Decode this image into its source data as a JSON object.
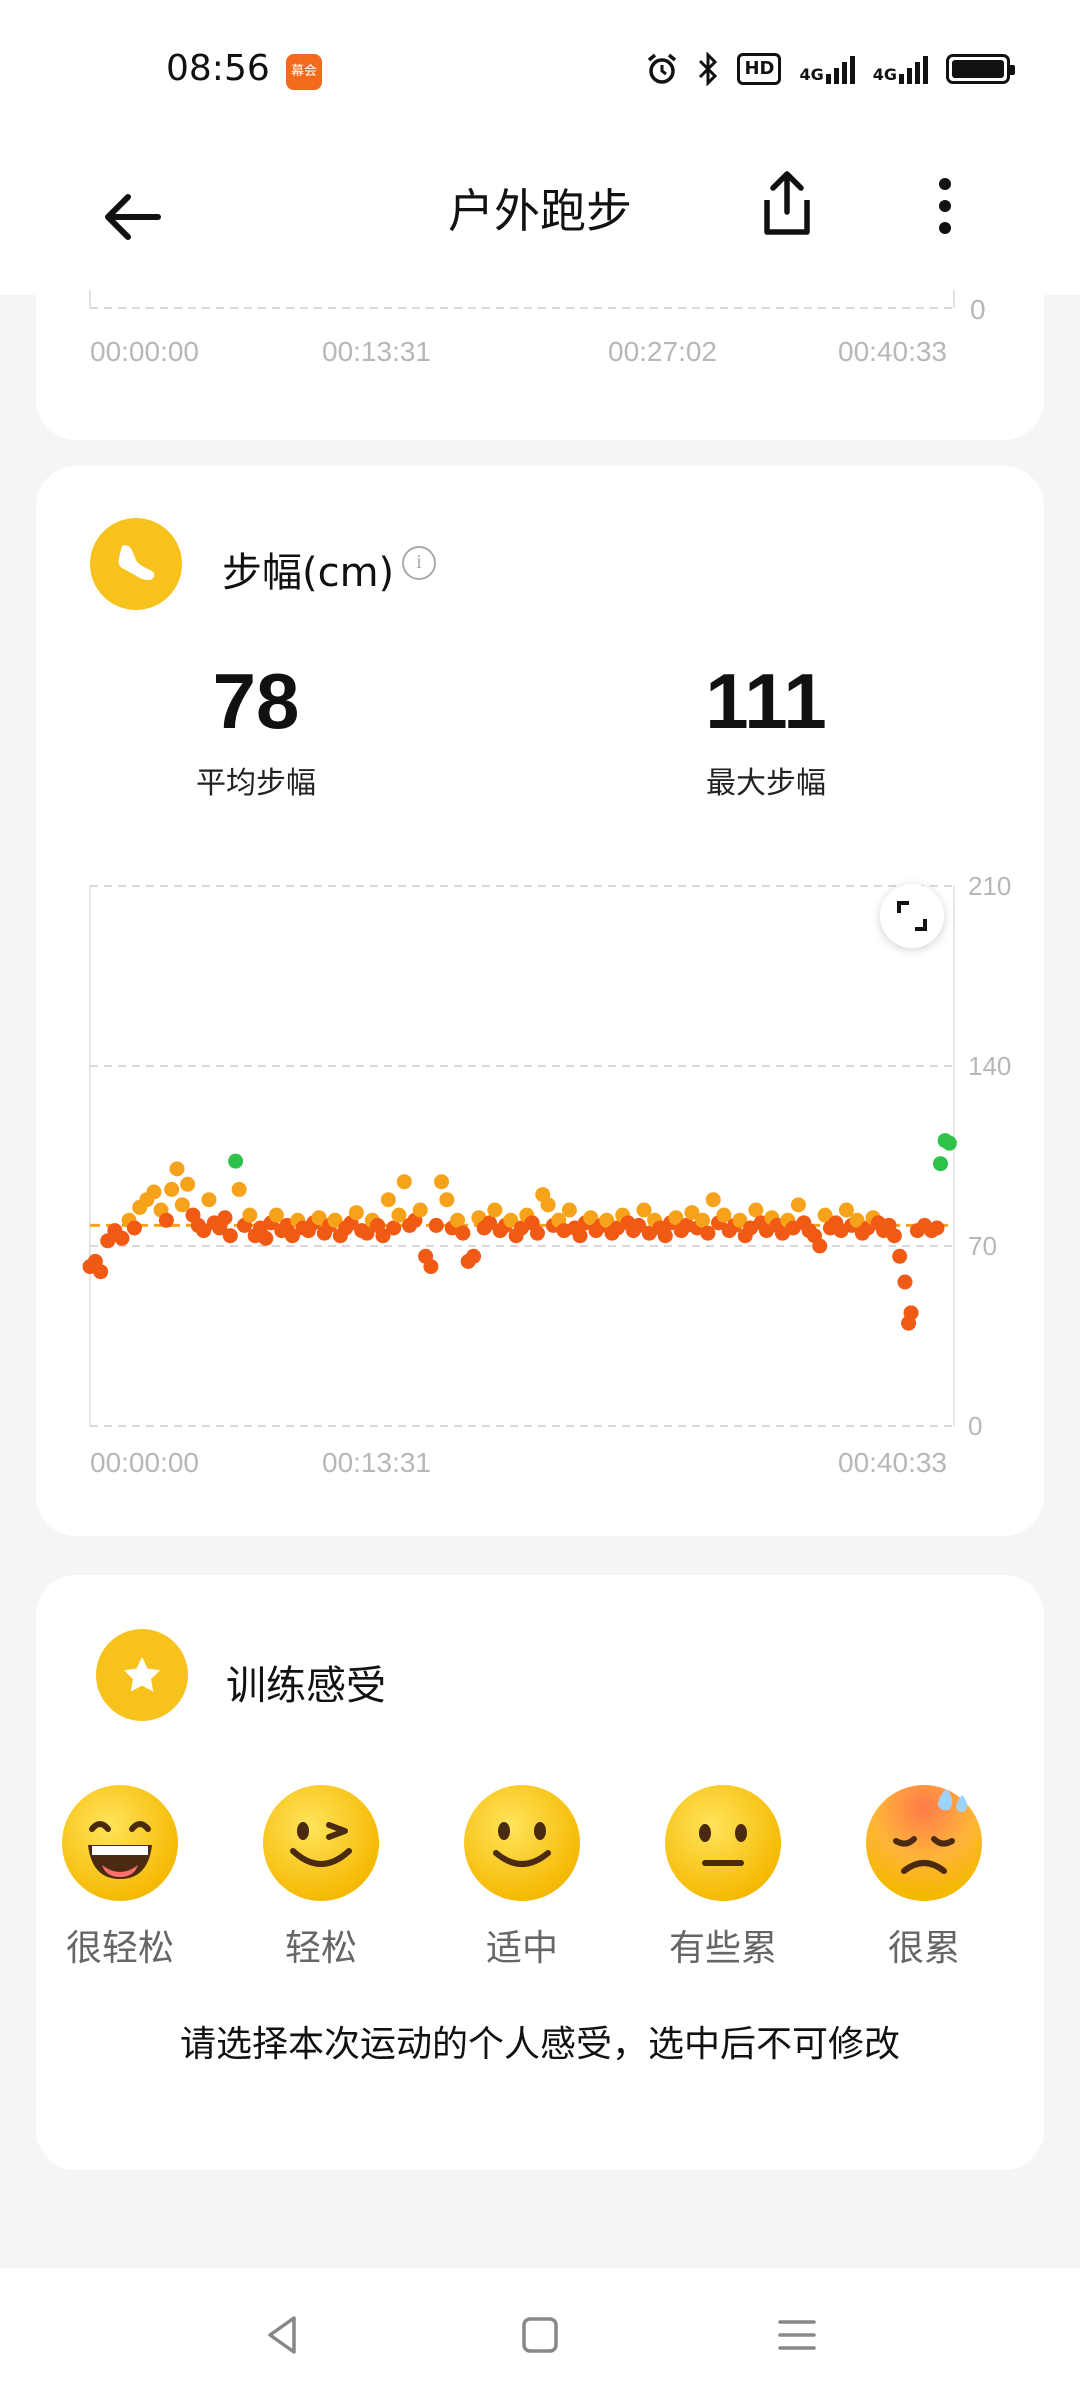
{
  "status_bar": {
    "time": "08:56",
    "app_badge": "幕会",
    "hd_label": "HD",
    "net1": "4G",
    "net2": "4G"
  },
  "header": {
    "title": "户外跑步"
  },
  "prev_chart": {
    "x_ticks": [
      "00:00:00",
      "00:13:31",
      "00:27:02",
      "00:40:33"
    ],
    "y_min_label": "0"
  },
  "stride_section": {
    "title": "步幅(cm)",
    "avg_value": "78",
    "avg_label": "平均步幅",
    "max_value": "111",
    "max_label": "最大步幅"
  },
  "chart_data": {
    "type": "scatter",
    "title": "",
    "xlabel": "",
    "ylabel": "",
    "ylim": [
      0,
      210
    ],
    "xlim_seconds": [
      0,
      2433
    ],
    "y_ticks": [
      "0",
      "70",
      "140",
      "210"
    ],
    "x_ticks": [
      "00:00:00",
      "00:13:31",
      "",
      "00:40:33"
    ],
    "average_line": 78,
    "grid": true,
    "colors": {
      "low": "#f05a14",
      "mid": "#f7a21b",
      "high": "#2fc24a",
      "avg_line": "#f7a21b"
    },
    "points": [
      [
        0,
        62,
        "low"
      ],
      [
        15,
        64,
        "low"
      ],
      [
        30,
        60,
        "low"
      ],
      [
        50,
        72,
        "low"
      ],
      [
        70,
        76,
        "low"
      ],
      [
        90,
        73,
        "low"
      ],
      [
        110,
        80,
        "mid"
      ],
      [
        125,
        77,
        "low"
      ],
      [
        140,
        85,
        "mid"
      ],
      [
        160,
        88,
        "mid"
      ],
      [
        180,
        91,
        "mid"
      ],
      [
        200,
        84,
        "mid"
      ],
      [
        215,
        80,
        "low"
      ],
      [
        230,
        92,
        "mid"
      ],
      [
        245,
        100,
        "mid"
      ],
      [
        260,
        86,
        "mid"
      ],
      [
        275,
        94,
        "mid"
      ],
      [
        290,
        82,
        "low"
      ],
      [
        305,
        78,
        "low"
      ],
      [
        320,
        76,
        "low"
      ],
      [
        335,
        88,
        "mid"
      ],
      [
        350,
        79,
        "low"
      ],
      [
        365,
        77,
        "low"
      ],
      [
        380,
        81,
        "low"
      ],
      [
        395,
        74,
        "low"
      ],
      [
        410,
        103,
        "high"
      ],
      [
        420,
        92,
        "mid"
      ],
      [
        435,
        78,
        "low"
      ],
      [
        450,
        82,
        "mid"
      ],
      [
        465,
        74,
        "low"
      ],
      [
        480,
        77,
        "low"
      ],
      [
        495,
        73,
        "low"
      ],
      [
        510,
        79,
        "low"
      ],
      [
        525,
        82,
        "mid"
      ],
      [
        540,
        76,
        "low"
      ],
      [
        555,
        78,
        "low"
      ],
      [
        570,
        74,
        "low"
      ],
      [
        585,
        80,
        "mid"
      ],
      [
        600,
        77,
        "low"
      ],
      [
        615,
        76,
        "low"
      ],
      [
        630,
        79,
        "low"
      ],
      [
        645,
        81,
        "mid"
      ],
      [
        660,
        75,
        "low"
      ],
      [
        675,
        78,
        "low"
      ],
      [
        690,
        80,
        "mid"
      ],
      [
        705,
        74,
        "low"
      ],
      [
        720,
        77,
        "low"
      ],
      [
        735,
        79,
        "low"
      ],
      [
        750,
        83,
        "mid"
      ],
      [
        765,
        76,
        "low"
      ],
      [
        780,
        75,
        "low"
      ],
      [
        795,
        80,
        "mid"
      ],
      [
        810,
        78,
        "low"
      ],
      [
        825,
        74,
        "low"
      ],
      [
        840,
        88,
        "mid"
      ],
      [
        855,
        77,
        "low"
      ],
      [
        870,
        82,
        "mid"
      ],
      [
        885,
        95,
        "mid"
      ],
      [
        900,
        78,
        "low"
      ],
      [
        915,
        80,
        "low"
      ],
      [
        930,
        84,
        "mid"
      ],
      [
        945,
        66,
        "low"
      ],
      [
        960,
        62,
        "low"
      ],
      [
        975,
        78,
        "low"
      ],
      [
        990,
        95,
        "mid"
      ],
      [
        1005,
        88,
        "mid"
      ],
      [
        1020,
        77,
        "low"
      ],
      [
        1035,
        80,
        "mid"
      ],
      [
        1050,
        75,
        "low"
      ],
      [
        1065,
        64,
        "low"
      ],
      [
        1080,
        66,
        "low"
      ],
      [
        1095,
        81,
        "mid"
      ],
      [
        1110,
        77,
        "low"
      ],
      [
        1125,
        79,
        "low"
      ],
      [
        1140,
        84,
        "mid"
      ],
      [
        1155,
        76,
        "low"
      ],
      [
        1170,
        78,
        "low"
      ],
      [
        1185,
        80,
        "mid"
      ],
      [
        1200,
        74,
        "low"
      ],
      [
        1215,
        77,
        "low"
      ],
      [
        1230,
        82,
        "mid"
      ],
      [
        1245,
        79,
        "low"
      ],
      [
        1260,
        75,
        "low"
      ],
      [
        1275,
        90,
        "mid"
      ],
      [
        1290,
        86,
        "mid"
      ],
      [
        1305,
        78,
        "low"
      ],
      [
        1320,
        80,
        "mid"
      ],
      [
        1335,
        76,
        "low"
      ],
      [
        1350,
        84,
        "mid"
      ],
      [
        1365,
        77,
        "low"
      ],
      [
        1380,
        74,
        "low"
      ],
      [
        1395,
        79,
        "low"
      ],
      [
        1410,
        81,
        "mid"
      ],
      [
        1425,
        76,
        "low"
      ],
      [
        1440,
        78,
        "low"
      ],
      [
        1455,
        80,
        "mid"
      ],
      [
        1470,
        75,
        "low"
      ],
      [
        1485,
        77,
        "low"
      ],
      [
        1500,
        82,
        "mid"
      ],
      [
        1515,
        79,
        "low"
      ],
      [
        1530,
        76,
        "low"
      ],
      [
        1545,
        78,
        "low"
      ],
      [
        1560,
        84,
        "mid"
      ],
      [
        1575,
        75,
        "low"
      ],
      [
        1590,
        80,
        "mid"
      ],
      [
        1605,
        77,
        "low"
      ],
      [
        1620,
        74,
        "low"
      ],
      [
        1635,
        79,
        "low"
      ],
      [
        1650,
        81,
        "mid"
      ],
      [
        1665,
        76,
        "low"
      ],
      [
        1680,
        78,
        "low"
      ],
      [
        1695,
        83,
        "mid"
      ],
      [
        1710,
        77,
        "low"
      ],
      [
        1725,
        80,
        "mid"
      ],
      [
        1740,
        75,
        "low"
      ],
      [
        1755,
        88,
        "mid"
      ],
      [
        1770,
        79,
        "low"
      ],
      [
        1785,
        82,
        "mid"
      ],
      [
        1800,
        76,
        "low"
      ],
      [
        1815,
        78,
        "low"
      ],
      [
        1830,
        80,
        "mid"
      ],
      [
        1845,
        74,
        "low"
      ],
      [
        1860,
        77,
        "low"
      ],
      [
        1875,
        84,
        "mid"
      ],
      [
        1890,
        79,
        "low"
      ],
      [
        1905,
        76,
        "low"
      ],
      [
        1920,
        81,
        "mid"
      ],
      [
        1935,
        78,
        "low"
      ],
      [
        1950,
        75,
        "low"
      ],
      [
        1965,
        80,
        "mid"
      ],
      [
        1980,
        77,
        "low"
      ],
      [
        1995,
        86,
        "mid"
      ],
      [
        2010,
        79,
        "low"
      ],
      [
        2025,
        76,
        "low"
      ],
      [
        2040,
        74,
        "low"
      ],
      [
        2055,
        70,
        "low"
      ],
      [
        2070,
        82,
        "mid"
      ],
      [
        2085,
        77,
        "low"
      ],
      [
        2100,
        79,
        "low"
      ],
      [
        2115,
        76,
        "low"
      ],
      [
        2130,
        84,
        "mid"
      ],
      [
        2145,
        78,
        "low"
      ],
      [
        2160,
        80,
        "mid"
      ],
      [
        2175,
        75,
        "low"
      ],
      [
        2190,
        77,
        "low"
      ],
      [
        2205,
        81,
        "mid"
      ],
      [
        2220,
        79,
        "low"
      ],
      [
        2235,
        76,
        "low"
      ],
      [
        2250,
        78,
        "low"
      ],
      [
        2265,
        74,
        "low"
      ],
      [
        2280,
        66,
        "low"
      ],
      [
        2295,
        56,
        "low"
      ],
      [
        2305,
        40,
        "low"
      ],
      [
        2312,
        44,
        "low"
      ],
      [
        2330,
        76,
        "low"
      ],
      [
        2350,
        78,
        "low"
      ],
      [
        2370,
        76,
        "low"
      ],
      [
        2385,
        77,
        "low"
      ],
      [
        2395,
        102,
        "high"
      ],
      [
        2408,
        111,
        "high"
      ],
      [
        2420,
        110,
        "high"
      ]
    ]
  },
  "feel_section": {
    "title": "训练感受",
    "options": [
      "很轻松",
      "轻松",
      "适中",
      "有些累",
      "很累"
    ],
    "note": "请选择本次运动的个人感受，选中后不可修改"
  }
}
